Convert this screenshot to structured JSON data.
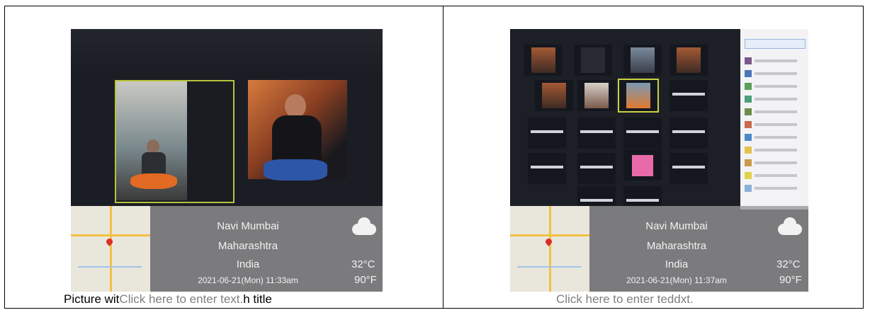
{
  "captions": {
    "left_prefix": "Picture wit",
    "left_placeholder": "Click here to enter text.",
    "left_suffix": "h title",
    "right": "Click here to enter teddxt."
  },
  "left_photo": {
    "weather": {
      "city": "Navi Mumbai",
      "state": "Maharashtra",
      "country": "India",
      "temp_c": "32°C",
      "temp_f": "90°F",
      "datetime": "2021-06-21(Mon) 11:33am",
      "icon": "cloud-icon"
    }
  },
  "right_photo": {
    "weather": {
      "city": "Navi Mumbai",
      "state": "Maharashtra",
      "country": "India",
      "temp_c": "32°C",
      "temp_f": "90°F",
      "datetime": "2021-06-21(Mon) 11:37am",
      "icon": "cloud-icon"
    }
  },
  "colors": {
    "border": "#000000",
    "placeholder": "#7f7f7f",
    "tile_highlight": "#b7c33d",
    "overlay": "#969696"
  }
}
